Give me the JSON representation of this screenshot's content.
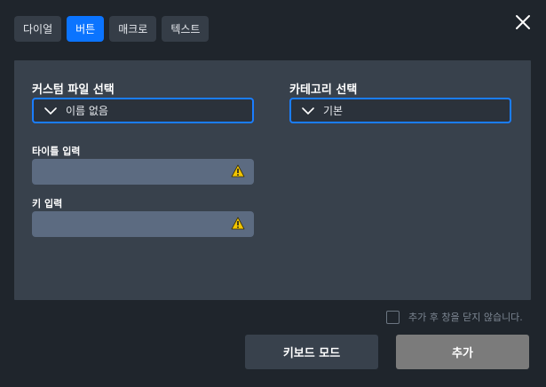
{
  "tabs": [
    {
      "label": "다이얼",
      "active": false
    },
    {
      "label": "버튼",
      "active": true
    },
    {
      "label": "매크로",
      "active": false
    },
    {
      "label": "텍스트",
      "active": false
    }
  ],
  "form": {
    "custom_file_label": "커스텀 파일 선택",
    "custom_file_value": "이름 없음",
    "category_label": "카테고리 선택",
    "category_value": "기본",
    "title_label": "타이틀 입력",
    "title_value": "",
    "key_label": "키 입력",
    "key_value": ""
  },
  "footer": {
    "keep_open_label": "추가 후 창을 닫지 않습니다.",
    "keep_open_checked": false,
    "keyboard_mode_label": "키보드 모드",
    "add_label": "추가"
  },
  "colors": {
    "accent": "#0b74ff",
    "warning": "#f2c500"
  },
  "icons": {
    "close": "close-icon",
    "dropdown": "chevron-down-icon",
    "warning": "warning-icon"
  }
}
